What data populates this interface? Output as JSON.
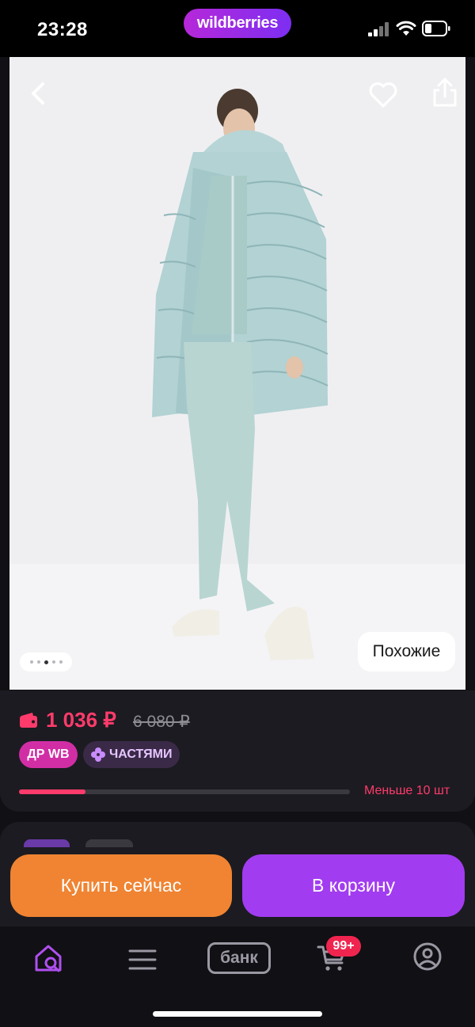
{
  "status_bar": {
    "time": "23:28",
    "brand": "wildberries"
  },
  "gallery": {
    "similar_label": "Похожие",
    "dot_count": 5,
    "active_dot": 3
  },
  "price": {
    "current": "1 036 ₽",
    "old": "6 080 ₽",
    "badge_dr": "ДР WB",
    "badge_parts": "ЧАСТЯМИ",
    "stock_text": "Меньше 10 шт",
    "stock_level": 0.2
  },
  "actions": {
    "buy_now": "Купить сейчас",
    "add_to_cart": "В корзину"
  },
  "bottom_nav": {
    "bank_label": "банк",
    "cart_count": "99+"
  },
  "colors": {
    "accent_pink": "#ff3b6b",
    "buy_orange": "#f08432",
    "cart_purple": "#a23cf0",
    "brand_gradient": [
      "#b628d9",
      "#7d2ef2"
    ]
  },
  "icons": [
    "back-icon",
    "heart-icon",
    "share-icon",
    "wallet-icon",
    "flower-icon",
    "home-search-icon",
    "menu-icon",
    "basket-icon",
    "profile-icon"
  ]
}
